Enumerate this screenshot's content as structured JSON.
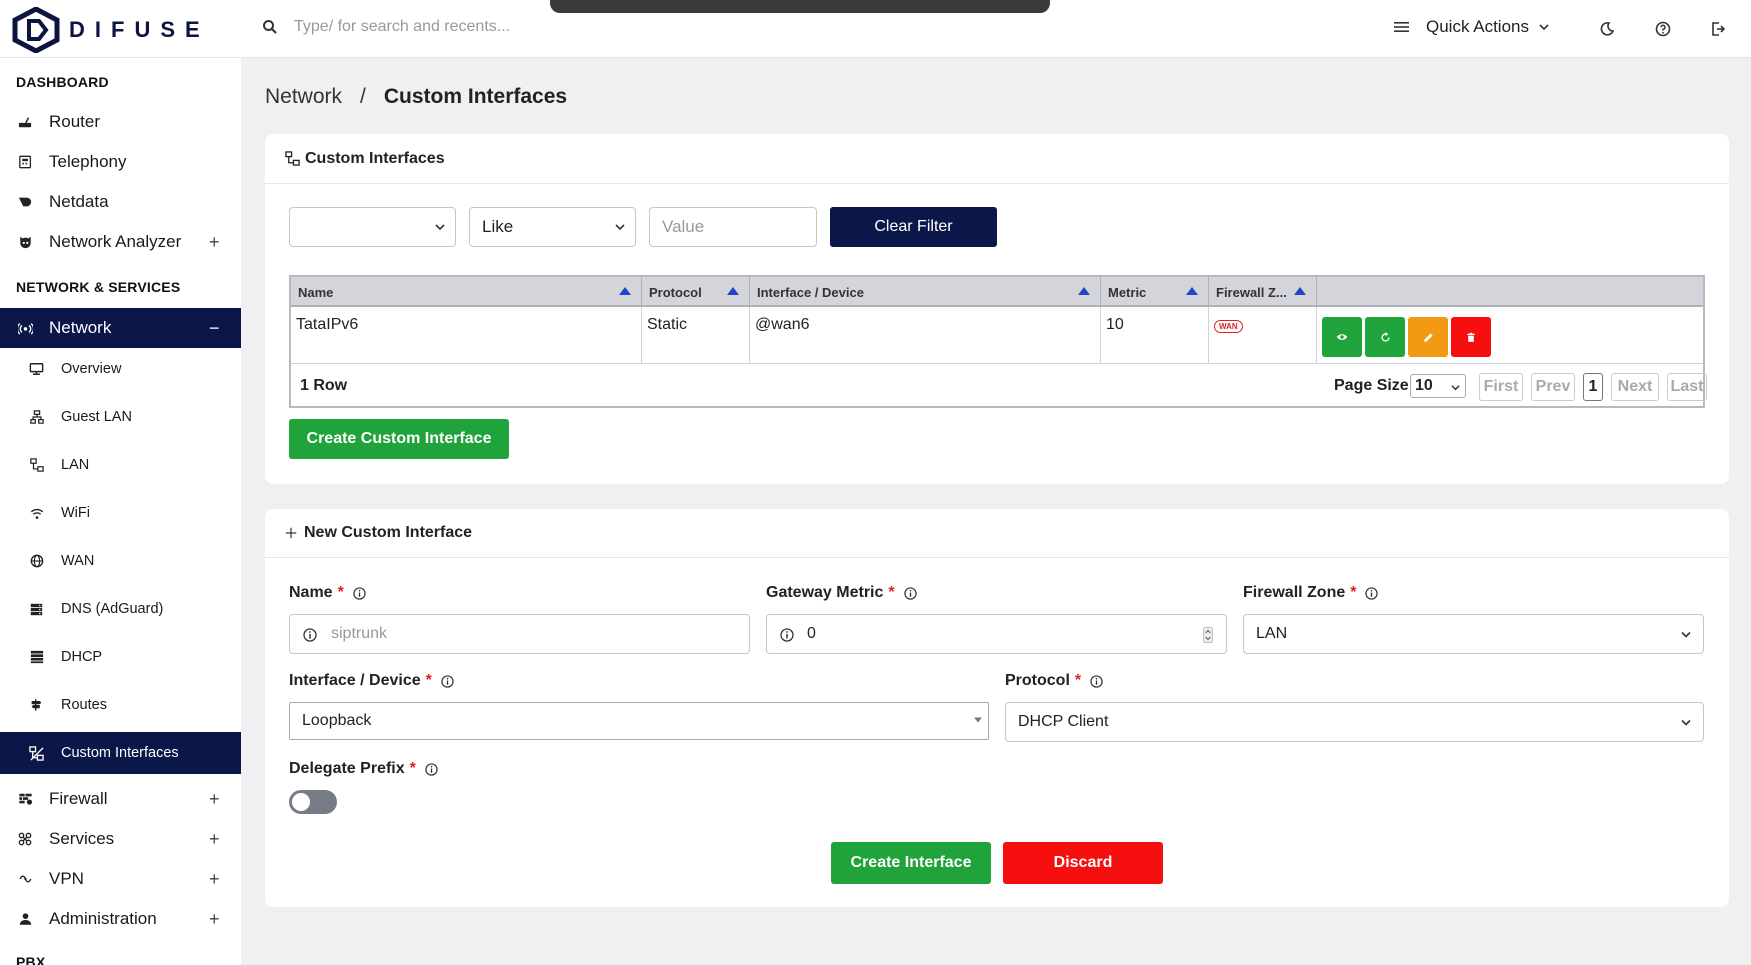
{
  "app": {
    "name": "DIFUSE"
  },
  "search": {
    "placeholder": "Type/ for search and recents..."
  },
  "header": {
    "quick_actions": "Quick Actions"
  },
  "sidebar": {
    "dashboard_heading": "DASHBOARD",
    "dashboard_items": [
      {
        "label": "Router"
      },
      {
        "label": "Telephony"
      },
      {
        "label": "Netdata"
      },
      {
        "label": "Network Analyzer",
        "expand": "+"
      }
    ],
    "network_heading": "NETWORK & SERVICES",
    "network_label": "Network",
    "network_collapse": "−",
    "network_subitems": [
      {
        "label": "Overview"
      },
      {
        "label": "Guest LAN"
      },
      {
        "label": "LAN"
      },
      {
        "label": "WiFi"
      },
      {
        "label": "WAN"
      },
      {
        "label": "DNS (AdGuard)"
      },
      {
        "label": "DHCP"
      },
      {
        "label": "Routes"
      },
      {
        "label": "Custom Interfaces"
      }
    ],
    "other_items": [
      {
        "label": "Firewall",
        "expand": "+"
      },
      {
        "label": "Services",
        "expand": "+"
      },
      {
        "label": "VPN",
        "expand": "+"
      },
      {
        "label": "Administration",
        "expand": "+"
      }
    ],
    "pbx_heading": "PBX"
  },
  "breadcrumb": {
    "parent": "Network",
    "separator": "/",
    "current": "Custom Interfaces"
  },
  "list_card": {
    "title": "Custom Interfaces",
    "filter": {
      "field_value": "",
      "operator": "Like",
      "value_placeholder": "Value",
      "clear_label": "Clear Filter"
    },
    "table": {
      "columns": [
        "Name",
        "Protocol",
        "Interface / Device",
        "Metric",
        "Firewall Z..."
      ],
      "rows": [
        {
          "name": "TataIPv6",
          "protocol": "Static",
          "device": "@wan6",
          "metric": "10",
          "zone": "WAN"
        }
      ],
      "row_count": "1 Row",
      "page_size_label": "Page Size",
      "page_size": "10",
      "pager": {
        "first": "First",
        "prev": "Prev",
        "page": "1",
        "next": "Next",
        "last": "Last"
      }
    },
    "create_label": "Create Custom Interface"
  },
  "form_card": {
    "title": "New Custom Interface",
    "name": {
      "label": "Name",
      "placeholder": "siptrunk"
    },
    "gateway_metric": {
      "label": "Gateway Metric",
      "value": "0"
    },
    "firewall_zone": {
      "label": "Firewall Zone",
      "value": "LAN"
    },
    "interface_device": {
      "label": "Interface / Device",
      "value": "Loopback"
    },
    "protocol": {
      "label": "Protocol",
      "value": "DHCP Client"
    },
    "delegate_prefix": {
      "label": "Delegate Prefix",
      "enabled": false
    },
    "required_mark": "*",
    "submit_label": "Create Interface",
    "discard_label": "Discard"
  },
  "colors": {
    "navy": "#0b1748",
    "green": "#1fa33a",
    "orange": "#f29a13",
    "red": "#f50f0f"
  }
}
